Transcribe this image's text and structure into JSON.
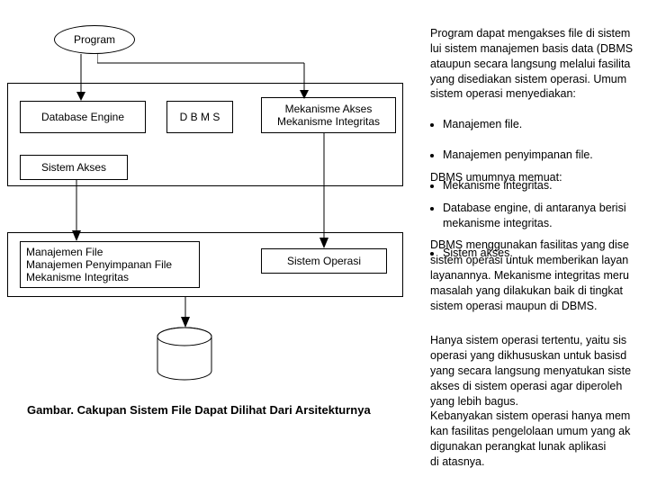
{
  "diagram": {
    "program": "Program",
    "database_engine": "Database Engine",
    "dbms": "D B M S",
    "mekanisme_box_line1": "Mekanisme Akses",
    "mekanisme_box_line2": "Mekanisme Integritas",
    "sistem_akses": "Sistem Akses",
    "os_box_line1": "Manajemen File",
    "os_box_line2": "Manajemen Penyimpanan File",
    "os_box_line3": "Mekanisme Integritas",
    "sistem_operasi": "Sistem Operasi",
    "caption": "Gambar. Cakupan Sistem File Dapat Dilihat Dari Arsitekturnya"
  },
  "text": {
    "p1_intro": "Program dapat mengakses file di sistem\nlui sistem manajemen basis data (DBMS\nataupun secara langsung melalui fasilita\nyang disediakan sistem operasi. Umum\nsistem operasi menyediakan:",
    "p1_b1": "Manajemen file.",
    "p1_b2": "Manajemen penyimpanan file.",
    "p1_b3": "Mekanisme integritas.",
    "p2_intro": "DBMS umumnya memuat:",
    "p2_b1": "Database engine, di antaranya berisi\nmekanisme integritas.",
    "p2_b2": "Sistem akses.",
    "p3": "DBMS menggunakan fasilitas yang dise\nsistem operasi untuk memberikan layan\nlayanannya. Mekanisme integritas meru\nmasalah yang dilakukan baik di tingkat\nsistem operasi maupun di DBMS.",
    "p4": "Hanya sistem operasi tertentu, yaitu sis\noperasi yang dikhususkan untuk basisd\nyang secara langsung menyatukan siste\nakses di sistem operasi agar diperoleh\nyang lebih bagus.\nKebanyakan sistem operasi hanya mem\nkan fasilitas pengelolaan umum yang ak\ndigunakan perangkat lunak aplikasi\ndi atasnya."
  }
}
